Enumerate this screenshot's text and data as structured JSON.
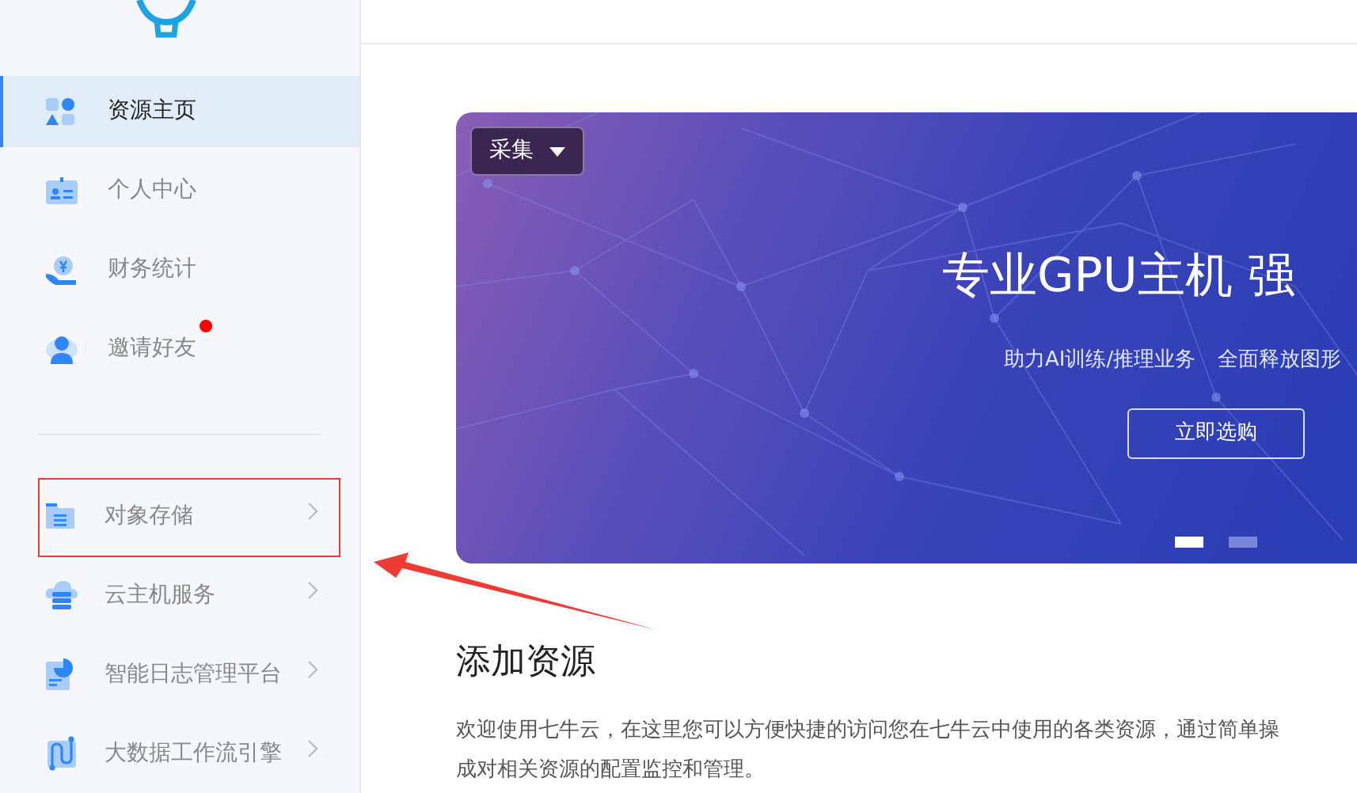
{
  "sidebar": {
    "nav": [
      {
        "label": "资源主页",
        "selected": true,
        "dot": false
      },
      {
        "label": "个人中心",
        "selected": false,
        "dot": false
      },
      {
        "label": "财务统计",
        "selected": false,
        "dot": false
      },
      {
        "label": "邀请好友",
        "selected": false,
        "dot": true
      }
    ],
    "products": [
      {
        "label": "对象存储",
        "marked": true
      },
      {
        "label": "云主机服务",
        "marked": false
      },
      {
        "label": "智能日志管理平台",
        "marked": false
      },
      {
        "label": "大数据工作流引擎",
        "marked": false
      }
    ]
  },
  "banner": {
    "dropdown": "采集",
    "title": "专业GPU主机 强",
    "subtitle": [
      "助力AI训练/推理业务",
      "全面释放图形"
    ],
    "button": "立即选购",
    "slides": [
      {
        "selected": true
      },
      {
        "selected": false
      }
    ]
  },
  "section": {
    "heading": "添加资源",
    "lines": [
      "欢迎使用七牛云，在这里您可以方便快捷的访问您在七牛云中使用的各类资源，通过简单操",
      "成对相关资源的配置监控和管理。"
    ]
  }
}
